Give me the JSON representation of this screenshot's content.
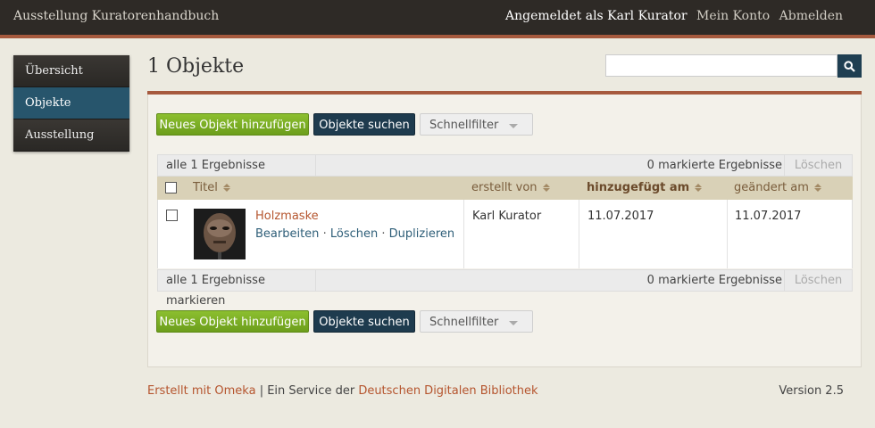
{
  "header": {
    "site_title": "Ausstellung Kuratorenhandbuch",
    "logged_in": "Angemeldet als Karl Kurator",
    "account": "Mein Konto",
    "logout": "Abmelden"
  },
  "sidebar": {
    "items": [
      {
        "label": "Übersicht"
      },
      {
        "label": "Objekte"
      },
      {
        "label": "Ausstellung"
      }
    ]
  },
  "page": {
    "title": "1 Objekte",
    "search_placeholder": ""
  },
  "toolbar": {
    "add_label": "Neues Objekt hinzufügen",
    "search_label": "Objekte suchen",
    "filter_label": "Schnellfilter"
  },
  "batch": {
    "select_all": "alle 1 Ergebnisse markieren",
    "selected_count": "0 markierte Ergebnisse",
    "delete": "Löschen"
  },
  "table": {
    "columns": [
      "Titel",
      "erstellt von",
      "hinzugefügt am",
      "geändert am"
    ],
    "rows": [
      {
        "title": "Holzmaske",
        "edit": "Bearbeiten",
        "delete": "Löschen",
        "duplicate": "Duplizieren",
        "separator": "·",
        "creator": "Karl Kurator",
        "added": "11.07.2017",
        "modified": "11.07.2017"
      }
    ]
  },
  "footer": {
    "made_with": "Erstellt mit Omeka",
    "service_text": "| Ein Service der",
    "ddb": "Deutschen Digitalen Bibliothek",
    "version": "Version 2.5"
  },
  "colors": {
    "header_bg": "#2e2a26",
    "accent": "#a65a3e",
    "nav_active": "#27556c",
    "primary_button": "#7aad24",
    "dark_button": "#1e3b4e",
    "link": "#b5552e"
  }
}
